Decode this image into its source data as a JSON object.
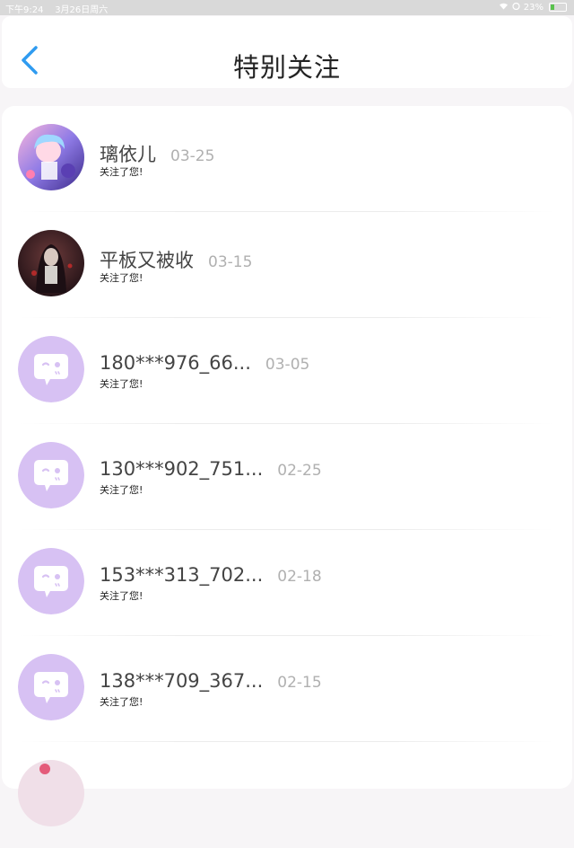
{
  "status": {
    "time": "下午9:24",
    "date": "3月26日周六",
    "battery": "23%"
  },
  "header": {
    "title": "特别关注",
    "back_icon": "chevron-left-icon",
    "accent": "#2f9bf0"
  },
  "rows": [
    {
      "name": "璃依儿",
      "date": "03-25",
      "sub": "关注了您!",
      "avatar": "photo-anime-pink"
    },
    {
      "name": "平板又被收",
      "date": "03-15",
      "sub": "关注了您!",
      "avatar": "photo-anime-dark"
    },
    {
      "name": "180***976_66...",
      "date": "03-05",
      "sub": "关注了您!",
      "avatar": "default-chat-bubble"
    },
    {
      "name": "130***902_751...",
      "date": "02-25",
      "sub": "关注了您!",
      "avatar": "default-chat-bubble"
    },
    {
      "name": "153***313_702...",
      "date": "02-18",
      "sub": "关注了您!",
      "avatar": "default-chat-bubble"
    },
    {
      "name": "138***709_367...",
      "date": "02-15",
      "sub": "关注了您!",
      "avatar": "default-chat-bubble"
    }
  ],
  "colors": {
    "default_avatar_bg": "#d7c1f3",
    "muted_date": "#b0b0b0"
  }
}
